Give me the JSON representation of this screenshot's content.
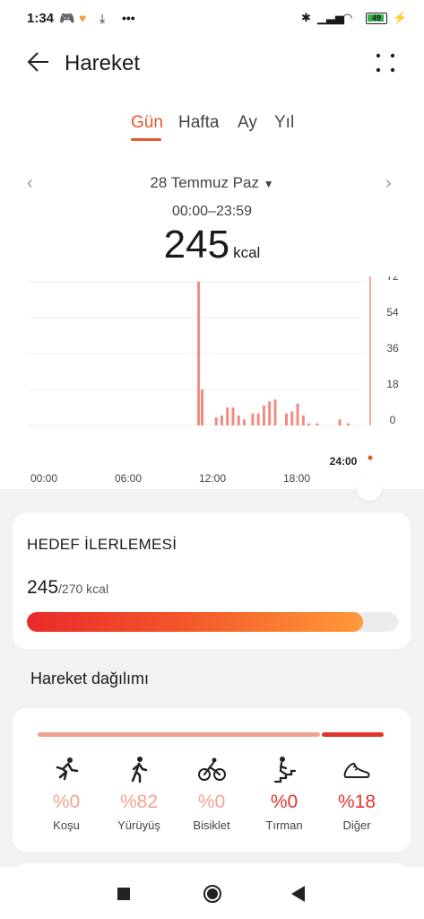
{
  "status": {
    "time": "1:34",
    "battery": "49"
  },
  "header": {
    "title": "Hareket"
  },
  "tabs": [
    {
      "label": "Gün",
      "active": true
    },
    {
      "label": "Hafta"
    },
    {
      "label": "Ay"
    },
    {
      "label": "Yıl"
    }
  ],
  "date": {
    "label": "28 Temmuz Paz",
    "dropdown_icon": "caret-down-icon"
  },
  "range": "00:00–23:59",
  "total": {
    "value": "245",
    "unit": "kcal"
  },
  "colors": {
    "accent": "#e4572e",
    "bar": "#f08c80",
    "other": "#e0362a"
  },
  "chart_data": {
    "type": "bar",
    "x_ticks": [
      "00:00",
      "06:00",
      "12:00",
      "18:00"
    ],
    "y_ticks": [
      "72",
      "54",
      "36",
      "18",
      "0"
    ],
    "ylim": [
      0,
      72
    ],
    "marker_label": "24:00",
    "values": [
      {
        "x": 11.75,
        "y": 72
      },
      {
        "x": 12.0,
        "y": 18
      },
      {
        "x": 13.0,
        "y": 4
      },
      {
        "x": 13.4,
        "y": 5
      },
      {
        "x": 13.8,
        "y": 9
      },
      {
        "x": 14.2,
        "y": 9
      },
      {
        "x": 14.6,
        "y": 5
      },
      {
        "x": 15.0,
        "y": 3
      },
      {
        "x": 15.6,
        "y": 6
      },
      {
        "x": 16.0,
        "y": 6
      },
      {
        "x": 16.4,
        "y": 10
      },
      {
        "x": 16.8,
        "y": 12
      },
      {
        "x": 17.2,
        "y": 13
      },
      {
        "x": 18.0,
        "y": 6
      },
      {
        "x": 18.4,
        "y": 7
      },
      {
        "x": 18.8,
        "y": 11
      },
      {
        "x": 19.2,
        "y": 5
      },
      {
        "x": 19.6,
        "y": 1
      },
      {
        "x": 20.2,
        "y": 1
      },
      {
        "x": 21.8,
        "y": 3
      },
      {
        "x": 22.4,
        "y": 1
      }
    ]
  },
  "goal": {
    "title": "HEDEF İLERLEMESİ",
    "value": "245",
    "target": "/270 kcal",
    "progress": 0.907
  },
  "distribution": {
    "title": "Hareket dağılımı",
    "bar": [
      {
        "fraction": 0.82,
        "color": "#f2a293"
      },
      {
        "fraction": 0.18,
        "color": "#e0362a"
      }
    ],
    "activities": [
      {
        "pct": "%0",
        "label": "Koşu",
        "icon": "running-icon",
        "color": "#f2a293"
      },
      {
        "pct": "%82",
        "label": "Yürüyüş",
        "icon": "walking-icon",
        "color": "#f2a293"
      },
      {
        "pct": "%0",
        "label": "Bisiklet",
        "icon": "cycling-icon",
        "color": "#f2a293"
      },
      {
        "pct": "%0",
        "label": "Tırman",
        "icon": "climbing-icon",
        "color": "#e0362a"
      },
      {
        "pct": "%18",
        "label": "Diğer",
        "icon": "shoe-icon",
        "color": "#e0362a"
      }
    ]
  }
}
